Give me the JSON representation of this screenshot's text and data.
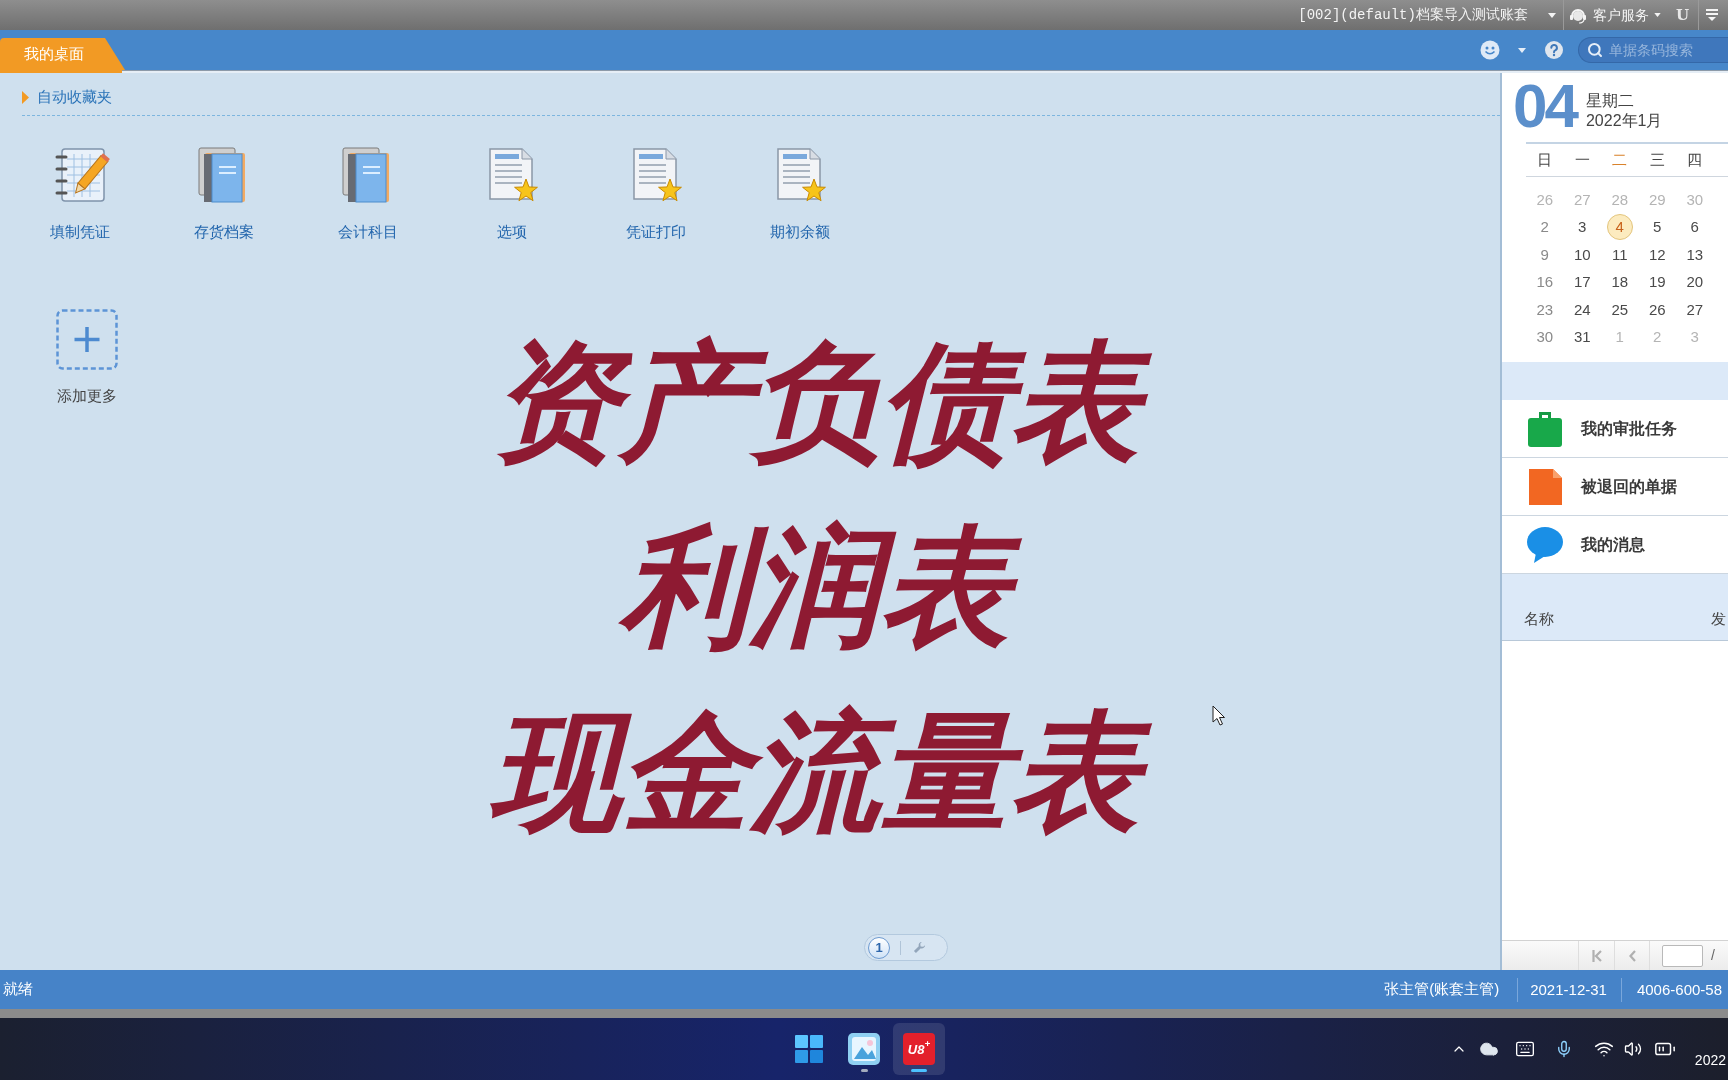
{
  "top_bar": {
    "account": "[002](default)档案导入测试账套",
    "service": "客户服务",
    "logo": "U"
  },
  "tab_bar": {
    "tabs": [
      {
        "label": "我的桌面",
        "selected": true
      }
    ],
    "search": {
      "placeholder": "单据条码搜索"
    }
  },
  "favorites": {
    "title": "自动收藏夹",
    "shortcuts": [
      {
        "label": "填制凭证",
        "kind": "notebook"
      },
      {
        "label": "存货档案",
        "kind": "books"
      },
      {
        "label": "会计科目",
        "kind": "books"
      },
      {
        "label": "选项",
        "kind": "document"
      },
      {
        "label": "凭证打印",
        "kind": "document"
      },
      {
        "label": "期初余额",
        "kind": "document"
      }
    ],
    "add_more": {
      "label": "添加更多"
    }
  },
  "overlay_title": {
    "lines": [
      "资产负债表",
      "利润表",
      "现金流量表"
    ]
  },
  "page_indicator": {
    "pages": [
      {
        "label": "1",
        "selected": true
      }
    ]
  },
  "calendar": {
    "day": "04",
    "weekday": "星期二",
    "month": "2022年1月",
    "weekdays": [
      {
        "label": "日",
        "selected": false,
        "weekend": true
      },
      {
        "label": "一",
        "selected": false,
        "weekend": false
      },
      {
        "label": "二",
        "selected": true,
        "weekend": false
      },
      {
        "label": "三",
        "selected": false,
        "weekend": false
      },
      {
        "label": "四",
        "selected": false,
        "weekend": false
      }
    ],
    "weeks": [
      [
        {
          "day": "26",
          "in_month": false,
          "selected": false
        },
        {
          "day": "27",
          "in_month": false,
          "selected": false
        },
        {
          "day": "28",
          "in_month": false,
          "selected": false
        },
        {
          "day": "29",
          "in_month": false,
          "selected": false
        },
        {
          "day": "30",
          "in_month": false,
          "selected": false
        }
      ],
      [
        {
          "day": "2",
          "in_month": true,
          "selected": false
        },
        {
          "day": "3",
          "in_month": true,
          "selected": false
        },
        {
          "day": "4",
          "in_month": true,
          "selected": true
        },
        {
          "day": "5",
          "in_month": true,
          "selected": false
        },
        {
          "day": "6",
          "in_month": true,
          "selected": false
        }
      ],
      [
        {
          "day": "9",
          "in_month": true,
          "selected": false
        },
        {
          "day": "10",
          "in_month": true,
          "selected": false
        },
        {
          "day": "11",
          "in_month": true,
          "selected": false
        },
        {
          "day": "12",
          "in_month": true,
          "selected": false
        },
        {
          "day": "13",
          "in_month": true,
          "selected": false
        }
      ],
      [
        {
          "day": "16",
          "in_month": true,
          "selected": false
        },
        {
          "day": "17",
          "in_month": true,
          "selected": false
        },
        {
          "day": "18",
          "in_month": true,
          "selected": false
        },
        {
          "day": "19",
          "in_month": true,
          "selected": false
        },
        {
          "day": "20",
          "in_month": true,
          "selected": false
        }
      ],
      [
        {
          "day": "23",
          "in_month": true,
          "selected": false
        },
        {
          "day": "24",
          "in_month": true,
          "selected": false
        },
        {
          "day": "25",
          "in_month": true,
          "selected": false
        },
        {
          "day": "26",
          "in_month": true,
          "selected": false
        },
        {
          "day": "27",
          "in_month": true,
          "selected": false
        }
      ],
      [
        {
          "day": "30",
          "in_month": true,
          "selected": false
        },
        {
          "day": "31",
          "in_month": true,
          "selected": false
        },
        {
          "day": "1",
          "in_month": false,
          "selected": false
        },
        {
          "day": "2",
          "in_month": false,
          "selected": false
        },
        {
          "day": "3",
          "in_month": false,
          "selected": false
        }
      ]
    ]
  },
  "tasks": [
    {
      "label": "我的审批任务",
      "kind": "approval"
    },
    {
      "label": "被退回的单据",
      "kind": "returned"
    },
    {
      "label": "我的消息",
      "kind": "message"
    }
  ],
  "message_list": {
    "columns": [
      "名称",
      "发"
    ],
    "pager": {
      "separator": "/"
    }
  },
  "status_bar": {
    "status": "就绪",
    "user": "张主管(账套主管)",
    "date": "2021-12-31",
    "phone": "4006-600-58"
  },
  "taskbar": {
    "apps": [
      {
        "kind": "picture",
        "running": true,
        "selected": false
      },
      {
        "kind": "logo",
        "label": "U8$^{+}$",
        "running": true,
        "selected": true
      }
    ],
    "clock": "2022"
  }
}
